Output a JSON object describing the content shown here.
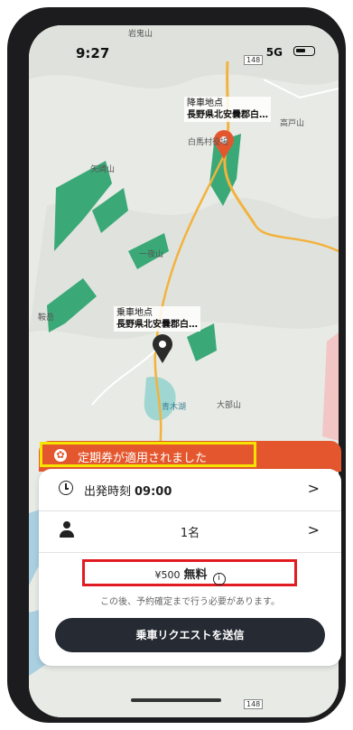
{
  "status_bar": {
    "time": "9:27",
    "network": "5G"
  },
  "map": {
    "place_labels": [
      "岩鬼山",
      "白馬村役場",
      "高戸山",
      "矢崎山",
      "一夜山",
      "鞍岳",
      "青木湖",
      "大部山"
    ],
    "road_numbers": [
      "148",
      "148"
    ],
    "dropoff": {
      "title": "降車地点",
      "address": "長野県北安曇郡白…"
    },
    "pickup": {
      "title": "乗車地点",
      "address": "長野県北安曇郡白…"
    }
  },
  "banner": {
    "text": "定期券が適用されました"
  },
  "booking": {
    "departure_label": "出発時刻",
    "departure_time": "09:00",
    "passengers": "1名",
    "old_price": "¥500",
    "price": "無料",
    "note": "この後、予約確定まで行う必要があります。",
    "submit_label": "乗車リクエストを送信"
  },
  "colors": {
    "banner": "#e4572e",
    "submit": "#252a33",
    "highlight_red": "#e11b22",
    "highlight_yellow": "#f5e300"
  }
}
